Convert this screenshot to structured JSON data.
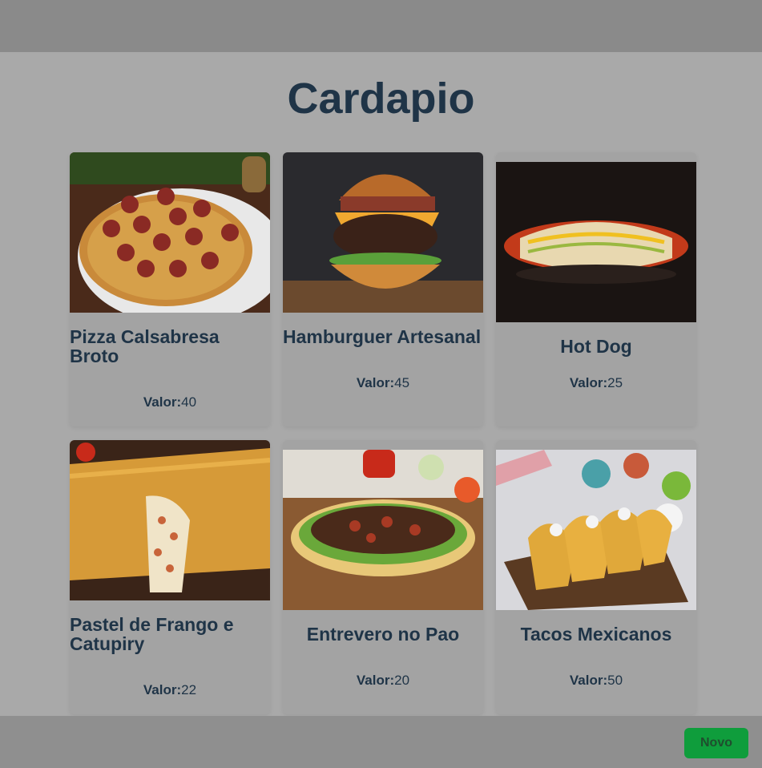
{
  "page": {
    "title": "Cardapio"
  },
  "price_label": "Valor:",
  "items": [
    {
      "name": "Pizza Calsabresa Broto",
      "price": "40",
      "image_icon": "pizza-image"
    },
    {
      "name": "Hamburguer Artesanal",
      "price": "45",
      "image_icon": "burger-image"
    },
    {
      "name": "Hot Dog",
      "price": "25",
      "image_icon": "hotdog-image"
    },
    {
      "name": "Pastel de Frango e Catupiry",
      "price": "22",
      "image_icon": "pastel-image"
    },
    {
      "name": "Entrevero no Pao",
      "price": "20",
      "image_icon": "entrevero-image"
    },
    {
      "name": "Tacos Mexicanos",
      "price": "50",
      "image_icon": "tacos-image"
    }
  ],
  "footer": {
    "new_button_label": "Novo"
  },
  "colors": {
    "title": "#1f3447",
    "button": "#0f9d3c",
    "overlay": "#a9a9a9"
  }
}
